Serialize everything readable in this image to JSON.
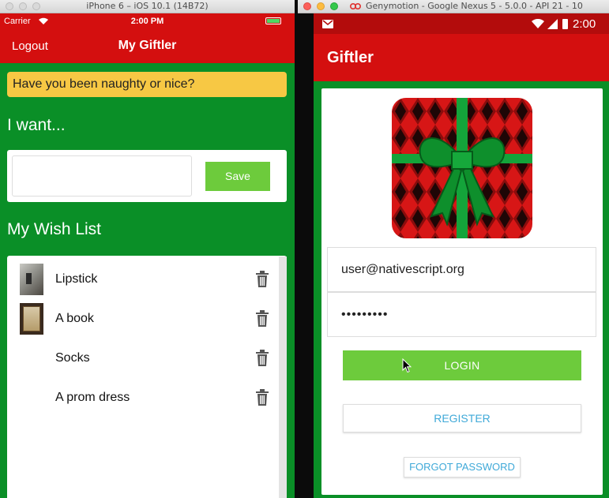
{
  "ios_window": {
    "title": "iPhone 6 – iOS 10.1 (14B72)"
  },
  "ios_status": {
    "carrier": "Carrier",
    "time": "2:00 PM"
  },
  "ios_nav": {
    "logout_label": "Logout",
    "title": "My Giftler"
  },
  "quote": {
    "text": "Have you been naughty or nice?"
  },
  "want": {
    "heading": "I want...",
    "input_value": "",
    "save_label": "Save"
  },
  "wishlist": {
    "heading": "My Wish List",
    "items": [
      {
        "label": "Lipstick",
        "has_photo": true
      },
      {
        "label": "A book",
        "has_photo": true
      },
      {
        "label": "Socks",
        "has_photo": false
      },
      {
        "label": "A prom dress",
        "has_photo": false
      }
    ]
  },
  "android_window": {
    "title": "Genymotion - Google Nexus 5 - 5.0.0 - API 21 - 10"
  },
  "android_status": {
    "time": "2:00"
  },
  "android_app": {
    "title": "Giftler"
  },
  "login": {
    "email_value": "user@nativescript.org",
    "password_value": "•••••••••",
    "login_label": "LOGIN",
    "register_label": "REGISTER",
    "forgot_label": "FORGOT PASSWORD"
  },
  "colors": {
    "brand_red": "#d40f0f",
    "brand_green": "#0a8f27",
    "button_green": "#6dcb3c",
    "link_blue": "#3fa9d8",
    "banner_yellow": "#f7c844"
  }
}
